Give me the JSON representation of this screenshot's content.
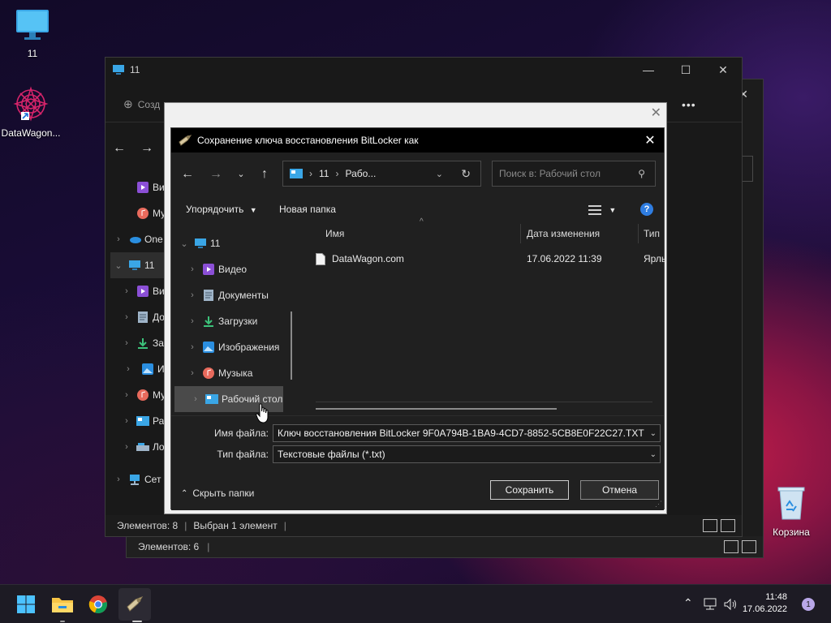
{
  "desktop": {
    "icons": [
      {
        "label": "11"
      },
      {
        "label": "DataWagon..."
      },
      {
        "label": "Корзина"
      }
    ]
  },
  "explorer_back": {
    "status": "Элементов: 6"
  },
  "explorer": {
    "title": "11",
    "ribbon_new": "Созд",
    "tree": [
      {
        "label": "Ви"
      },
      {
        "label": "Му"
      },
      {
        "label": "One"
      },
      {
        "label": "11"
      },
      {
        "label": "Ви"
      },
      {
        "label": "До"
      },
      {
        "label": "За"
      },
      {
        "label": "Из"
      },
      {
        "label": "Му"
      },
      {
        "label": "Ра"
      },
      {
        "label": "Ло"
      },
      {
        "label": "Сет"
      }
    ],
    "status_items": "Элементов: 8",
    "status_selected": "Выбран 1 элемент",
    "more_label": "•••"
  },
  "dialog": {
    "title": "Сохранение ключа восстановления BitLocker как",
    "breadcrumb": [
      "11",
      "Рабо..."
    ],
    "search_placeholder": "Поиск в: Рабочий стол",
    "organize": "Упорядочить",
    "new_folder": "Новая папка",
    "help": "?",
    "tree": [
      {
        "label": "11"
      },
      {
        "label": "Видео"
      },
      {
        "label": "Документы"
      },
      {
        "label": "Загрузки"
      },
      {
        "label": "Изображения"
      },
      {
        "label": "Музыка"
      },
      {
        "label": "Рабочий стол"
      }
    ],
    "columns": {
      "name": "Имя",
      "date": "Дата изменения",
      "type": "Тип"
    },
    "files": [
      {
        "name": "DataWagon.com",
        "date": "17.06.2022 11:39",
        "type": "Ярль"
      }
    ],
    "filename_label": "Имя файла:",
    "filename_value": "Ключ восстановления BitLocker 9F0A794B-1BA9-4CD7-8852-5CB8E0F22C27.TXT",
    "filetype_label": "Тип файла:",
    "filetype_value": "Текстовые файлы (*.txt)",
    "hide_folders": "Скрыть папки",
    "save": "Сохранить",
    "cancel": "Отмена"
  },
  "taskbar": {
    "time": "11:48",
    "date": "17.06.2022",
    "notifications": "1"
  },
  "colors": {
    "accent": "#2f7de1",
    "dialog_bg": "#202020",
    "title_bg": "#000000"
  }
}
